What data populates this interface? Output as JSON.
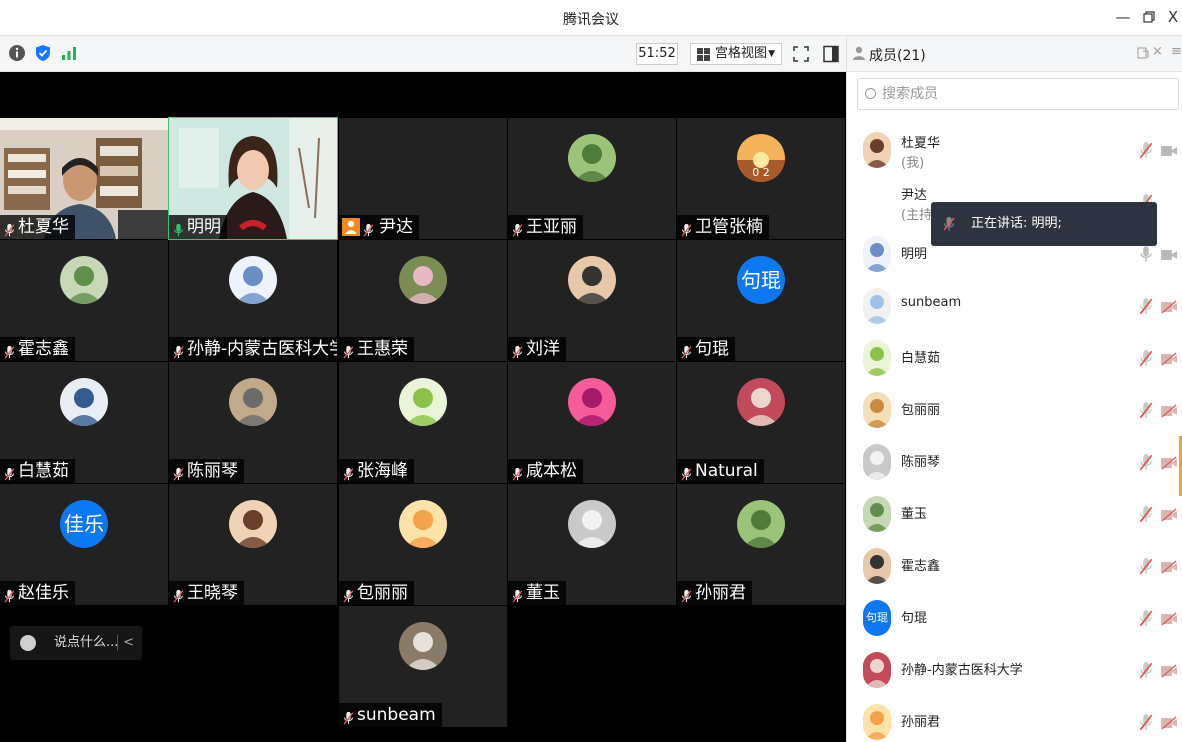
{
  "window": {
    "title": "腾讯会议",
    "minimize": "—",
    "restore": "ਹ",
    "close": "X"
  },
  "toolbar": {
    "timer": "51:52",
    "view_mode": "宫格视图",
    "view_caret": "▼"
  },
  "participants_panel": {
    "title": "成员(21)",
    "search_placeholder": "搜索成员",
    "members": [
      {
        "name": "杜夏华",
        "sub": "(我)",
        "mic": "muted",
        "cam": "on"
      },
      {
        "name": "尹达",
        "sub": "(主持人)",
        "mic": "muted",
        "cam": "none"
      },
      {
        "name": "明明",
        "sub": "",
        "mic": "on",
        "cam": "on"
      },
      {
        "name": "sunbeam",
        "sub": "",
        "mic": "muted",
        "cam": "off"
      },
      {
        "name": "白慧茹",
        "sub": "",
        "mic": "muted",
        "cam": "off"
      },
      {
        "name": "包丽丽",
        "sub": "",
        "mic": "muted",
        "cam": "off"
      },
      {
        "name": "陈丽琴",
        "sub": "",
        "mic": "muted",
        "cam": "off"
      },
      {
        "name": "董玉",
        "sub": "",
        "mic": "muted",
        "cam": "off"
      },
      {
        "name": "霍志鑫",
        "sub": "",
        "mic": "muted",
        "cam": "off"
      },
      {
        "name": "句琨",
        "sub": "",
        "mic": "muted",
        "cam": "off"
      },
      {
        "name": "孙静-内蒙古医科大学",
        "sub": "",
        "mic": "muted",
        "cam": "off"
      },
      {
        "name": "孙丽君",
        "sub": "",
        "mic": "muted",
        "cam": "off"
      }
    ],
    "speaking_tooltip": "正在讲话: 明明;",
    "text_avatar": "句琨"
  },
  "video_grid": {
    "tiles": [
      {
        "name": "杜夏华",
        "kind": "video"
      },
      {
        "name": "明明",
        "kind": "video"
      },
      {
        "name": "尹达",
        "kind": "host"
      },
      {
        "name": "王亚丽",
        "kind": "avatar"
      },
      {
        "name": "卫管张楠",
        "kind": "avatar"
      },
      {
        "name": "霍志鑫",
        "kind": "avatar"
      },
      {
        "name": "孙静-内蒙古医科大学",
        "kind": "avatar"
      },
      {
        "name": "王惠荣",
        "kind": "avatar"
      },
      {
        "name": "刘洋",
        "kind": "avatar"
      },
      {
        "name": "句琨",
        "kind": "text",
        "avatar_text": "句琨"
      },
      {
        "name": "白慧茹",
        "kind": "avatar"
      },
      {
        "name": "陈丽琴",
        "kind": "avatar"
      },
      {
        "name": "张海峰",
        "kind": "avatar"
      },
      {
        "name": "咸本松",
        "kind": "avatar"
      },
      {
        "name": "Natural",
        "kind": "avatar"
      },
      {
        "name": "赵佳乐",
        "kind": "text",
        "avatar_text": "佳乐"
      },
      {
        "name": "王晓琴",
        "kind": "avatar"
      },
      {
        "name": "包丽丽",
        "kind": "avatar"
      },
      {
        "name": "董玉",
        "kind": "avatar"
      },
      {
        "name": "孙丽君",
        "kind": "avatar"
      },
      {
        "name": "sunbeam",
        "kind": "avatar"
      }
    ],
    "chat_placeholder": "说点什么...",
    "chat_collapse": "<",
    "avatar_overlay_text": "0 2"
  },
  "colors": {
    "accent": "#0e78f0",
    "muted_red": "#e05a5a",
    "mic_green": "#2fc26a",
    "host_orange": "#f08a1c",
    "active_border": "#36c96b"
  }
}
